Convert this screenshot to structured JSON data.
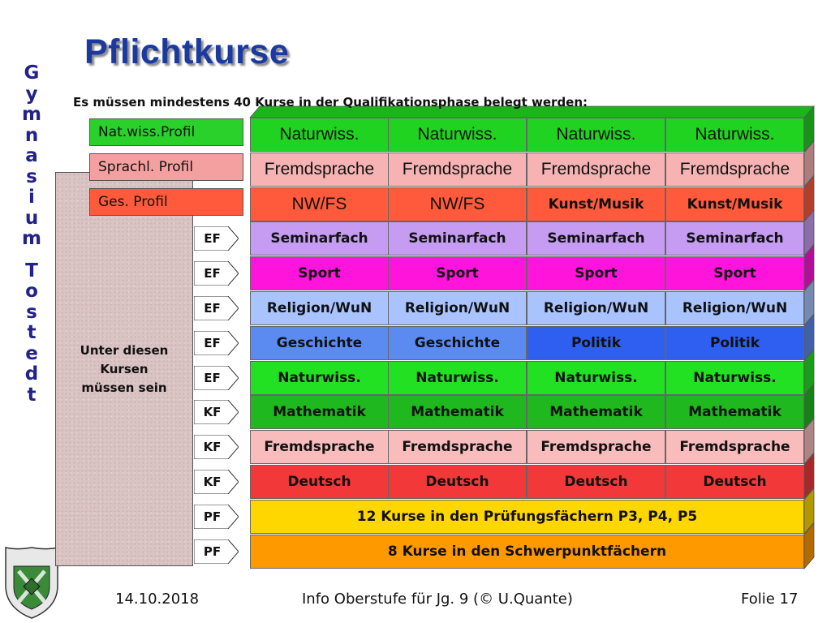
{
  "slide": {
    "vertical_title": [
      "G",
      "y",
      "m",
      "n",
      "a",
      "s",
      "i",
      "u",
      "m",
      "",
      "T",
      "o",
      "s",
      "t",
      "e",
      "d",
      "t"
    ],
    "title": "Pflichtkurse",
    "subtitle": "Es müssen mindestens 40 Kurse in der Qualifikationsphase belegt werden:",
    "logo_text": "GYMNASIUM TOSTEDT"
  },
  "profiles": [
    {
      "label": "Nat.wiss.Profil",
      "color": "#2bd12b"
    },
    {
      "label": "Sprachl. Profil",
      "color": "#f4a0a0"
    },
    {
      "label": "Ges. Profil",
      "color": "#ff5a3c"
    }
  ],
  "note": {
    "lines": [
      "Unter diesen",
      "Kursen",
      "müssen sein"
    ]
  },
  "rows": [
    {
      "label": "",
      "color": "#21d321",
      "big": true,
      "cells": [
        "Naturwiss.",
        "Naturwiss.",
        "Naturwiss.",
        "Naturwiss."
      ]
    },
    {
      "label": "",
      "color": "#f7b3b3",
      "big": true,
      "cells": [
        "Fremdsprache",
        "Fremdsprache",
        "Fremdsprache",
        "Fremdsprache"
      ]
    },
    {
      "label": "",
      "color": "#ff5a3c",
      "big": true,
      "cells": [
        "NW/FS",
        "NW/FS",
        "Kunst/Musik",
        "Kunst/Musik"
      ]
    },
    {
      "label": "EF",
      "color": "#c59cf2",
      "big": false,
      "cells": [
        "Seminarfach",
        "Seminarfach",
        "Seminarfach",
        "Seminarfach"
      ]
    },
    {
      "label": "EF",
      "color": "#ff14dc",
      "big": false,
      "cells": [
        "Sport",
        "Sport",
        "Sport",
        "Sport"
      ]
    },
    {
      "label": "EF",
      "color": "#a9c3ff",
      "big": false,
      "cells": [
        "Religion/WuN",
        "Religion/WuN",
        "Religion/WuN",
        "Religion/WuN"
      ]
    },
    {
      "label": "EF",
      "colors": [
        "#5b8bf0",
        "#5b8bf0",
        "#2f5ff0",
        "#2f5ff0"
      ],
      "color": "#5b8bf0",
      "big": false,
      "cells": [
        "Geschichte",
        "Geschichte",
        "Politik",
        "Politik"
      ]
    },
    {
      "label": "EF",
      "color": "#22e022",
      "big": false,
      "cells": [
        "Naturwiss.",
        "Naturwiss.",
        "Naturwiss.",
        "Naturwiss."
      ]
    },
    {
      "label": "KF",
      "color": "#1fb81f",
      "big": false,
      "cells": [
        "Mathematik",
        "Mathematik",
        "Mathematik",
        "Mathematik"
      ]
    },
    {
      "label": "KF",
      "color": "#f8bcbc",
      "big": false,
      "cells": [
        "Fremdsprache",
        "Fremdsprache",
        "Fremdsprache",
        "Fremdsprache"
      ]
    },
    {
      "label": "KF",
      "color": "#f23838",
      "big": false,
      "cells": [
        "Deutsch",
        "Deutsch",
        "Deutsch",
        "Deutsch"
      ]
    },
    {
      "label": "PF",
      "color": "#ffd700",
      "big": false,
      "wide": "12 Kurse in den Prüfungsfächern P3, P4, P5"
    },
    {
      "label": "PF",
      "color": "#ff9900",
      "big": false,
      "wide": "8 Kurse in den Schwerpunktfächern"
    }
  ],
  "footer": {
    "date": "14.10.2018",
    "center": "Info Oberstufe für Jg. 9 (© U.Quante)",
    "page": "Folie 17"
  }
}
